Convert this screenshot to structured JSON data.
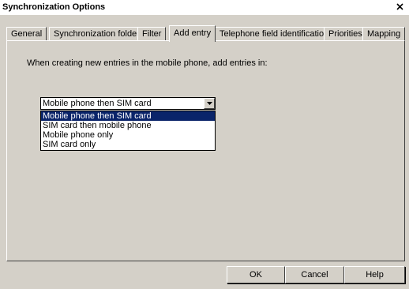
{
  "window": {
    "title": "Synchronization Options",
    "close_glyph": "X"
  },
  "tabs": [
    {
      "label": "General"
    },
    {
      "label": "Synchronization folder"
    },
    {
      "label": "Filter"
    },
    {
      "label": "Add entry",
      "active": true
    },
    {
      "label": "Telephone field identification"
    },
    {
      "label": "Priorities"
    },
    {
      "label": "Mapping"
    }
  ],
  "add_entry": {
    "prompt": "When creating new entries in the mobile phone, add entries in:",
    "combo": {
      "value": "Mobile phone then SIM card",
      "options": [
        "Mobile phone then SIM card",
        "SIM card then mobile phone",
        "Mobile phone only",
        "SIM card only"
      ],
      "highlighted_index": 0
    }
  },
  "buttons": {
    "ok": "OK",
    "cancel": "Cancel",
    "help": "Help"
  },
  "colors": {
    "face": "#d4d0c8",
    "highlight": "#0a246a"
  }
}
